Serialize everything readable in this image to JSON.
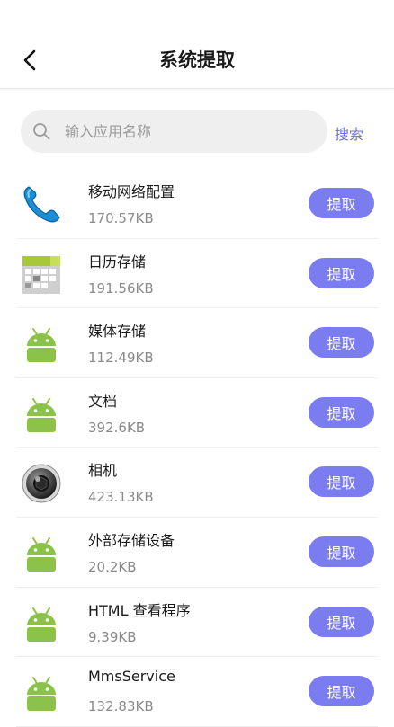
{
  "header": {
    "title": "系统提取",
    "back_icon": "chevron-left-icon"
  },
  "search": {
    "placeholder": "输入应用名称",
    "value": "",
    "button_label": "搜索",
    "icon": "search-icon"
  },
  "apps": [
    {
      "name": "移动网络配置",
      "size": "170.57KB",
      "icon": "phone-icon",
      "action": "提取"
    },
    {
      "name": "日历存储",
      "size": "191.56KB",
      "icon": "calendar-icon",
      "action": "提取"
    },
    {
      "name": "媒体存储",
      "size": "112.49KB",
      "icon": "android-icon",
      "action": "提取"
    },
    {
      "name": "文档",
      "size": "392.6KB",
      "icon": "android-icon",
      "action": "提取"
    },
    {
      "name": "相机",
      "size": "423.13KB",
      "icon": "camera-icon",
      "action": "提取"
    },
    {
      "name": "外部存储设备",
      "size": "20.2KB",
      "icon": "android-icon",
      "action": "提取"
    },
    {
      "name": "HTML 查看程序",
      "size": "9.39KB",
      "icon": "android-icon",
      "action": "提取"
    },
    {
      "name": "MmsService",
      "size": "132.83KB",
      "icon": "android-icon",
      "action": "提取"
    }
  ],
  "colors": {
    "accent": "#7b7cf0",
    "link": "#6b6ff0",
    "android_green": "#8bc34a"
  }
}
